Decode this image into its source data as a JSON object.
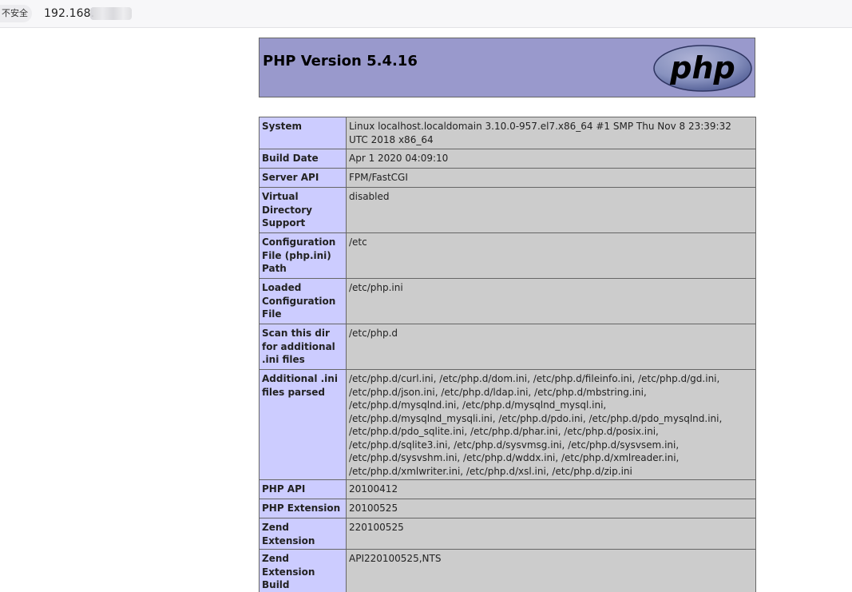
{
  "browser": {
    "security_label": "不安全",
    "url_visible": "192.168."
  },
  "header": {
    "title": "PHP Version 5.4.16",
    "logo_text": "php"
  },
  "rows": [
    {
      "key": "System",
      "value": "Linux localhost.localdomain 3.10.0-957.el7.x86_64 #1 SMP Thu Nov 8 23:39:32 UTC 2018 x86_64"
    },
    {
      "key": "Build Date",
      "value": "Apr 1 2020 04:09:10"
    },
    {
      "key": "Server API",
      "value": "FPM/FastCGI"
    },
    {
      "key": "Virtual Directory Support",
      "value": "disabled"
    },
    {
      "key": "Configuration File (php.ini) Path",
      "value": "/etc"
    },
    {
      "key": "Loaded Configuration File",
      "value": "/etc/php.ini"
    },
    {
      "key": "Scan this dir for additional .ini files",
      "value": "/etc/php.d"
    },
    {
      "key": "Additional .ini files parsed",
      "value": "/etc/php.d/curl.ini, /etc/php.d/dom.ini, /etc/php.d/fileinfo.ini, /etc/php.d/gd.ini, /etc/php.d/json.ini, /etc/php.d/ldap.ini, /etc/php.d/mbstring.ini, /etc/php.d/mysqlnd.ini, /etc/php.d/mysqlnd_mysql.ini, /etc/php.d/mysqlnd_mysqli.ini, /etc/php.d/pdo.ini, /etc/php.d/pdo_mysqlnd.ini, /etc/php.d/pdo_sqlite.ini, /etc/php.d/phar.ini, /etc/php.d/posix.ini, /etc/php.d/sqlite3.ini, /etc/php.d/sysvmsg.ini, /etc/php.d/sysvsem.ini, /etc/php.d/sysvshm.ini, /etc/php.d/wddx.ini, /etc/php.d/xmlreader.ini, /etc/php.d/xmlwriter.ini, /etc/php.d/xsl.ini, /etc/php.d/zip.ini"
    },
    {
      "key": "PHP API",
      "value": "20100412"
    },
    {
      "key": "PHP Extension",
      "value": "20100525"
    },
    {
      "key": "Zend Extension",
      "value": "220100525"
    },
    {
      "key": "Zend Extension Build",
      "value": "API220100525,NTS"
    }
  ],
  "colors": {
    "header_bg": "#9999cc",
    "key_cell_bg": "#ccccff",
    "value_cell_bg": "#cccccc",
    "logo_fill": "#8892bf",
    "logo_text": "#000000"
  }
}
